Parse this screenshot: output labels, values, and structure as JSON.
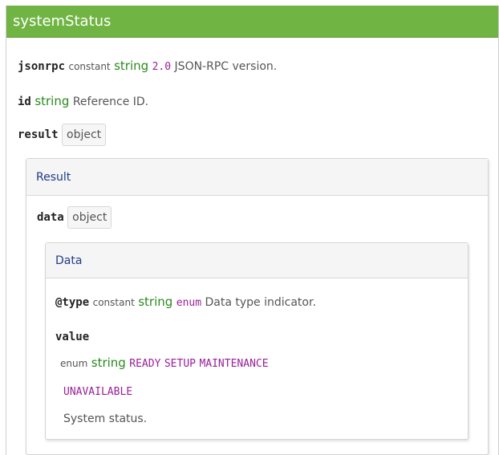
{
  "title": "systemStatus",
  "jsonrpc": {
    "name": "jsonrpc",
    "constant": "constant",
    "type": "string",
    "value": "2.0",
    "description": "JSON-RPC version."
  },
  "id": {
    "name": "id",
    "type": "string",
    "description": "Reference ID."
  },
  "result": {
    "name": "result",
    "type_badge": "object",
    "panel_title": "Result",
    "data": {
      "name": "data",
      "type_badge": "object",
      "panel_title": "Data",
      "type_field": {
        "name": "@type",
        "constant": "constant",
        "type": "string",
        "enum": "enum",
        "description": "Data type indicator."
      },
      "value_field": {
        "name": "value",
        "enum_label": "enum",
        "type": "string",
        "values": [
          "READY",
          "SETUP",
          "MAINTENANCE",
          "UNAVAILABLE"
        ],
        "description": "System status."
      }
    }
  },
  "colors": {
    "header_bg": "#70b443",
    "type_green": "#2a8a1e",
    "value_purple": "#9a1e9a",
    "panel_title_blue": "#1f3c88"
  }
}
